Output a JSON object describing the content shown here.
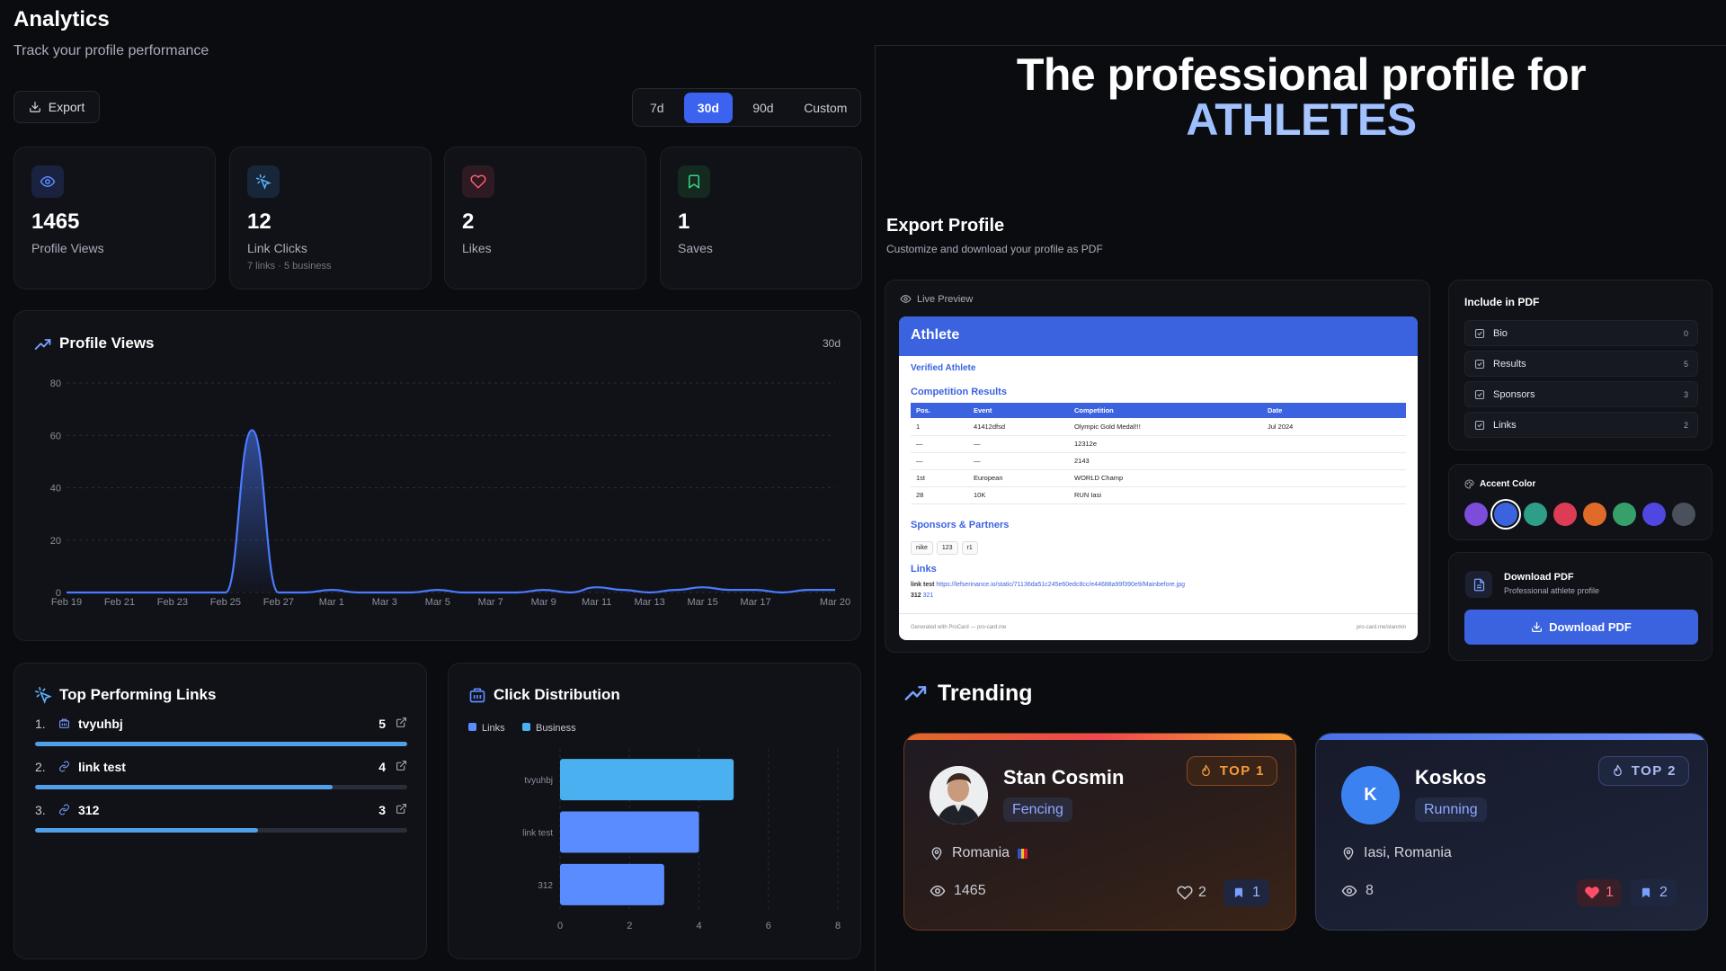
{
  "analytics": {
    "title": "Analytics",
    "subtitle": "Track your profile performance",
    "export_label": "Export",
    "ranges": [
      "7d",
      "30d",
      "90d",
      "Custom"
    ],
    "active_range": "30d",
    "stats": [
      {
        "icon": "eye-icon",
        "value": "1465",
        "label": "Profile Views",
        "sub": "",
        "color": "#5b8cff"
      },
      {
        "icon": "cursor-click-icon",
        "value": "12",
        "label": "Link Clicks",
        "sub": "7 links · 5 business",
        "color": "#5ab4ff"
      },
      {
        "icon": "heart-icon",
        "value": "2",
        "label": "Likes",
        "sub": "",
        "color": "#ff5a6e"
      },
      {
        "icon": "bookmark-icon",
        "value": "1",
        "label": "Saves",
        "sub": "",
        "color": "#37d58a"
      }
    ]
  },
  "profile_views": {
    "title": "Profile Views",
    "range": "30d",
    "chart_data": {
      "type": "area",
      "x": [
        "Feb 19",
        "Feb 20",
        "Feb 21",
        "Feb 22",
        "Feb 23",
        "Feb 24",
        "Feb 25",
        "Feb 26",
        "Feb 27",
        "Feb 28",
        "Mar 1",
        "Mar 2",
        "Mar 3",
        "Mar 4",
        "Mar 5",
        "Mar 6",
        "Mar 7",
        "Mar 8",
        "Mar 9",
        "Mar 10",
        "Mar 11",
        "Mar 12",
        "Mar 13",
        "Mar 14",
        "Mar 15",
        "Mar 16",
        "Mar 17",
        "Mar 18",
        "Mar 19",
        "Mar 20"
      ],
      "x_ticks": [
        "Feb 19",
        "Feb 21",
        "Feb 23",
        "Feb 25",
        "Feb 27",
        "Mar 1",
        "Mar 3",
        "Mar 5",
        "Mar 7",
        "Mar 9",
        "Mar 11",
        "Mar 13",
        "Mar 15",
        "Mar 17",
        "Mar 20"
      ],
      "values": [
        0,
        0,
        0,
        0,
        0,
        0,
        0,
        62,
        0,
        0,
        1,
        0,
        0,
        0,
        1,
        0,
        0,
        0,
        1,
        0,
        2,
        1,
        0,
        1,
        2,
        1,
        1,
        0,
        1,
        1
      ],
      "ylim": [
        0,
        80
      ],
      "y_ticks": [
        0,
        20,
        40,
        60,
        80
      ],
      "grid": true,
      "color": "#4b7bff"
    }
  },
  "top_links": {
    "title": "Top Performing Links",
    "items": [
      {
        "rank": "1.",
        "icon": "building-icon",
        "name": "tvyuhbj",
        "count": "5",
        "fraction": 1.0
      },
      {
        "rank": "2.",
        "icon": "link-icon",
        "name": "link test",
        "count": "4",
        "fraction": 0.8
      },
      {
        "rank": "3.",
        "icon": "link-icon",
        "name": "312",
        "count": "3",
        "fraction": 0.6
      }
    ]
  },
  "click_distribution": {
    "title": "Click Distribution",
    "chart_data": {
      "type": "bar",
      "orientation": "horizontal",
      "categories": [
        "tvyuhbj",
        "link test",
        "312"
      ],
      "series": [
        {
          "name": "Links",
          "color": "#5b8cff"
        },
        {
          "name": "Business",
          "color": "#4ab0f0"
        }
      ],
      "values": [
        5,
        4,
        3
      ],
      "bar_colors": [
        "#4ab0f0",
        "#5b8cff",
        "#5b8cff"
      ],
      "xlim": [
        0,
        8
      ],
      "x_ticks": [
        0,
        2,
        4,
        6,
        8
      ],
      "legend": "top-left"
    }
  },
  "hero": {
    "line1": "The professional profile for",
    "line2": "ATHLETES"
  },
  "export_profile": {
    "title": "Export Profile",
    "subtitle": "Customize and download your profile as PDF",
    "live_preview_label": "Live Preview",
    "pdf": {
      "name": "Athlete",
      "verified": "Verified Athlete",
      "results_heading": "Competition Results",
      "columns": [
        "Pos.",
        "Event",
        "Competition",
        "Date"
      ],
      "rows": [
        [
          "1",
          "41412dfsd",
          "Olympic Gold Medal!!!",
          "Jul 2024"
        ],
        [
          "—",
          "—",
          "12312e",
          ""
        ],
        [
          "—",
          "—",
          "2143",
          ""
        ],
        [
          "1st",
          "European",
          "WORLD Champ",
          ""
        ],
        [
          "28",
          "10K",
          "RUN Iasi",
          ""
        ]
      ],
      "sponsors_heading": "Sponsors & Partners",
      "sponsors": [
        "nike",
        "123",
        "r1"
      ],
      "links_heading": "Links",
      "links": [
        {
          "label": "link test",
          "url": "https://lefserinance.io/static/71136da51c245e60edc8cc/e44688a99f390e9/Mainbefore.jpg"
        },
        {
          "label": "312",
          "url": "321"
        }
      ],
      "footer_left": "Generated with ProCard — pro-card.me",
      "footer_right": "pro-card.me/stanmin"
    },
    "include_title": "Include in PDF",
    "include_items": [
      {
        "label": "Bio",
        "count": "0"
      },
      {
        "label": "Results",
        "count": "5"
      },
      {
        "label": "Sponsors",
        "count": "3"
      },
      {
        "label": "Links",
        "count": "2"
      }
    ],
    "accent_title": "Accent Color",
    "accent_colors": [
      "#7c4ddb",
      "#3b63e0",
      "#2e9e88",
      "#dc3d55",
      "#e06a28",
      "#37a06a",
      "#5046e0",
      "#4a505c"
    ],
    "accent_selected": 1,
    "download_title": "Download PDF",
    "download_sub": "Professional athlete profile",
    "download_button": "Download PDF"
  },
  "trending": {
    "title": "Trending",
    "cards": [
      {
        "name": "Stan Cosmin",
        "sport": "Fencing",
        "badge": "TOP 1",
        "location": "Romania",
        "flag": "🇷🇴",
        "views": "1465",
        "likes": "2",
        "saves": "1",
        "avatar": "photo"
      },
      {
        "name": "Koskos",
        "sport": "Running",
        "badge": "TOP 2",
        "location": "Iasi, Romania",
        "flag": "",
        "views": "8",
        "likes": "1",
        "saves": "2",
        "avatar": "K"
      }
    ]
  }
}
